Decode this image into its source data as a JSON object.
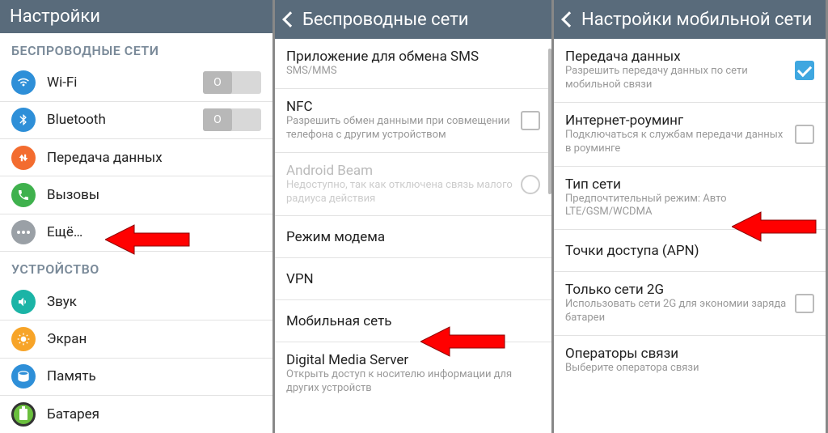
{
  "panel1": {
    "title": "Настройки",
    "section_wireless": "БЕСПРОВОДНЫЕ СЕТИ",
    "section_device": "УСТРОЙСТВО",
    "items": {
      "wifi": "Wi-Fi",
      "bluetooth": "Bluetooth",
      "data": "Передача данных",
      "calls": "Вызовы",
      "more": "Ещё…",
      "sound": "Звук",
      "display": "Экран",
      "storage": "Память",
      "battery": "Батарея"
    },
    "toggle_off_label": "O"
  },
  "panel2": {
    "title": "Беспроводные сети",
    "sms": {
      "title": "Приложение для обмена SMS",
      "sub": "SMS/MMS"
    },
    "nfc": {
      "title": "NFC",
      "sub": "Разрешить обмен данными при совмещении телефона с другим устройством"
    },
    "beam": {
      "title": "Android Beam",
      "sub": "Недоступно, так как отключена связь малого радиуса действия"
    },
    "tether": {
      "title": "Режим модема"
    },
    "vpn": {
      "title": "VPN"
    },
    "mobile": {
      "title": "Мобильная сеть"
    },
    "dms": {
      "title": "Digital Media Server",
      "sub": "Открыть доступ к носителю информации для других устройств"
    }
  },
  "panel3": {
    "title": "Настройки мобильной сети",
    "data": {
      "title": "Передача данных",
      "sub": "Разрешить передачу данных по сети мобильной связи"
    },
    "roaming": {
      "title": "Интернет-роуминг",
      "sub": "Подключаться к службам передачи данных в роуминге"
    },
    "nettype": {
      "title": "Тип сети",
      "sub": "Предпочтительный режим: Авто LTE/GSM/WCDMA"
    },
    "apn": {
      "title": "Точки доступа (APN)"
    },
    "only2g": {
      "title": "Только сети 2G",
      "sub": "Использовать сети 2G для экономии заряда батареи"
    },
    "operators": {
      "title": "Операторы связи",
      "sub": "Выберите оператора связи"
    }
  },
  "colors": {
    "wifi": "#2e8fd8",
    "bt": "#2e8fd8",
    "data": "#f36c2f",
    "calls": "#3fb14d",
    "more": "#9aa0a6",
    "sound": "#1bb4a6",
    "display": "#f7a428",
    "storage": "#2e8fd8",
    "battery": "#6abf3e"
  }
}
